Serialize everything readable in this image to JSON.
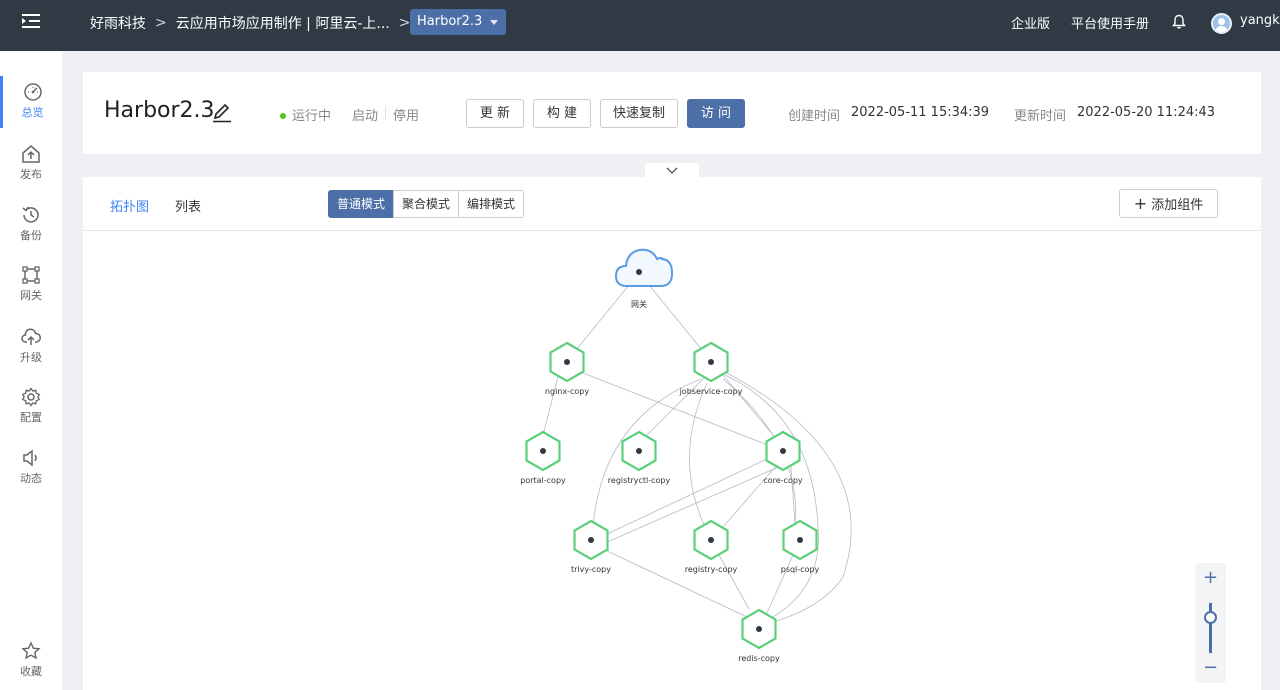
{
  "topbar": {
    "breadcrumb": [
      "好雨科技",
      "云应用市场应用制作 | 阿里云-上...",
      "Harbor2.3"
    ],
    "separator": ">",
    "enterprise_label": "企业版",
    "manual_label": "平台使用手册",
    "username": "yangk"
  },
  "sidebar": {
    "items": [
      {
        "label": "总览",
        "icon": "dashboard-icon",
        "active": true
      },
      {
        "label": "发布",
        "icon": "publish-icon"
      },
      {
        "label": "备份",
        "icon": "backup-icon"
      },
      {
        "label": "网关",
        "icon": "gateway-icon"
      },
      {
        "label": "升级",
        "icon": "upgrade-icon"
      },
      {
        "label": "配置",
        "icon": "gear-icon"
      },
      {
        "label": "动态",
        "icon": "speaker-icon"
      }
    ],
    "favorite_label": "收藏"
  },
  "header": {
    "app_name": "Harbor2.3",
    "status": "运行中",
    "start_label": "启动",
    "stop_label": "停用",
    "buttons": [
      "更 新",
      "构 建",
      "快速复制",
      "访 问"
    ],
    "created_label": "创建时间",
    "created_value": "2022-05-11 15:34:39",
    "updated_label": "更新时间",
    "updated_value": "2022-05-20 11:24:43"
  },
  "main": {
    "tabs": [
      "拓扑图",
      "列表"
    ],
    "modes": [
      "普通模式",
      "聚合模式",
      "编排模式"
    ],
    "active_mode": "普通模式",
    "add_component_label": "添加组件",
    "zoom_in": "+",
    "zoom_out": "−"
  },
  "topology": {
    "gateway": "网关",
    "components": [
      "nginx-copy",
      "jobservice-copy",
      "portal-copy",
      "registryctl-copy",
      "core-copy",
      "trivy-copy",
      "registry-copy",
      "psql-copy",
      "redis-copy"
    ]
  },
  "colors": {
    "accent": "#4d6fa8",
    "link": "#3b82f6",
    "node_stroke": "#5ccf7a",
    "cloud_stroke": "#5b9be0",
    "running": "#52c41a"
  }
}
